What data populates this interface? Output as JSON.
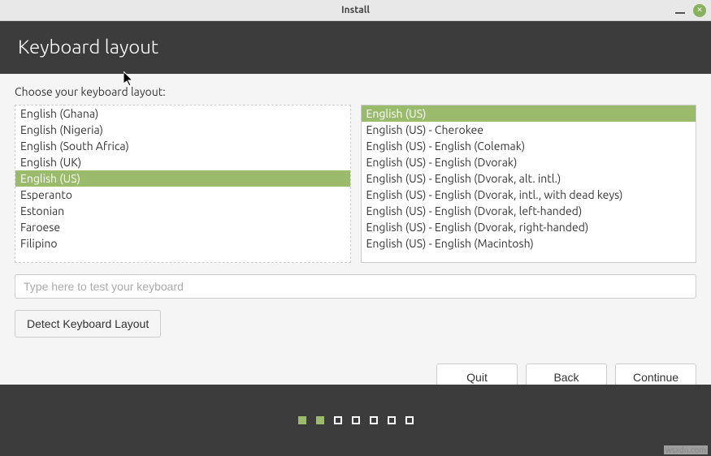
{
  "window": {
    "title": "Install"
  },
  "header": {
    "title": "Keyboard layout"
  },
  "prompt": "Choose your keyboard layout:",
  "left_list": [
    "English (Ghana)",
    "English (Nigeria)",
    "English (South Africa)",
    "English (UK)",
    "English (US)",
    "Esperanto",
    "Estonian",
    "Faroese",
    "Filipino"
  ],
  "left_selected_index": 4,
  "right_list": [
    "English (US)",
    "English (US) - Cherokee",
    "English (US) - English (Colemak)",
    "English (US) - English (Dvorak)",
    "English (US) - English (Dvorak, alt. intl.)",
    "English (US) - English (Dvorak, intl., with dead keys)",
    "English (US) - English (Dvorak, left-handed)",
    "English (US) - English (Dvorak, right-handed)",
    "English (US) - English (Macintosh)"
  ],
  "right_selected_index": 0,
  "test_input": {
    "placeholder": "Type here to test your keyboard",
    "value": ""
  },
  "buttons": {
    "detect": "Detect Keyboard Layout",
    "quit": "Quit",
    "back": "Back",
    "continue": "Continue"
  },
  "progress": {
    "total": 7,
    "active": [
      0,
      1
    ]
  },
  "watermark": "wsxdn.com"
}
